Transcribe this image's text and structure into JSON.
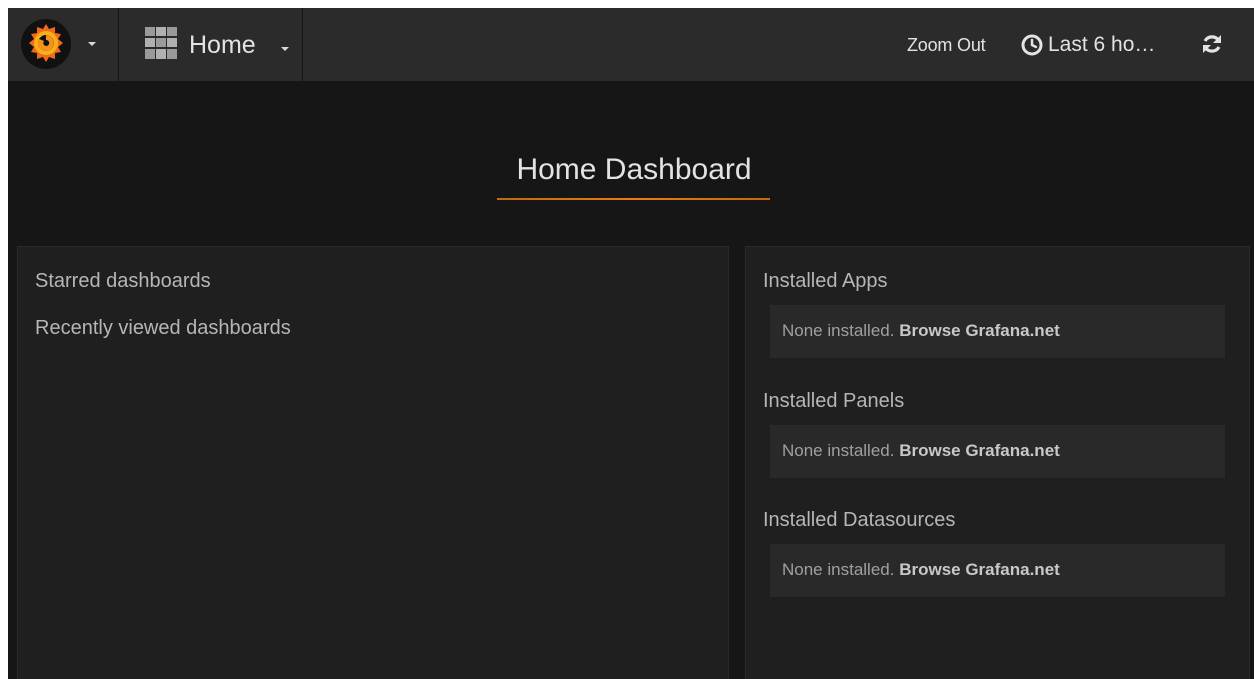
{
  "navbar": {
    "dashboard_title": "Home",
    "zoom_out_label": "Zoom Out",
    "time_range_label": "Last 6 ho…",
    "icons": {
      "logo": "grafana-logo-icon",
      "dashboards": "dashboard-grid-icon",
      "time": "clock-icon",
      "refresh": "refresh-icon"
    }
  },
  "page": {
    "title": "Home Dashboard",
    "accent_color": "#eb7b18"
  },
  "left_panel": {
    "starred_label": "Starred dashboards",
    "recent_label": "Recently viewed dashboards"
  },
  "right_panel": {
    "sections": [
      {
        "title": "Installed Apps",
        "empty_text": "None installed.",
        "link_text": "Browse Grafana.net"
      },
      {
        "title": "Installed Panels",
        "empty_text": "None installed.",
        "link_text": "Browse Grafana.net"
      },
      {
        "title": "Installed Datasources",
        "empty_text": "None installed.",
        "link_text": "Browse Grafana.net"
      }
    ]
  }
}
